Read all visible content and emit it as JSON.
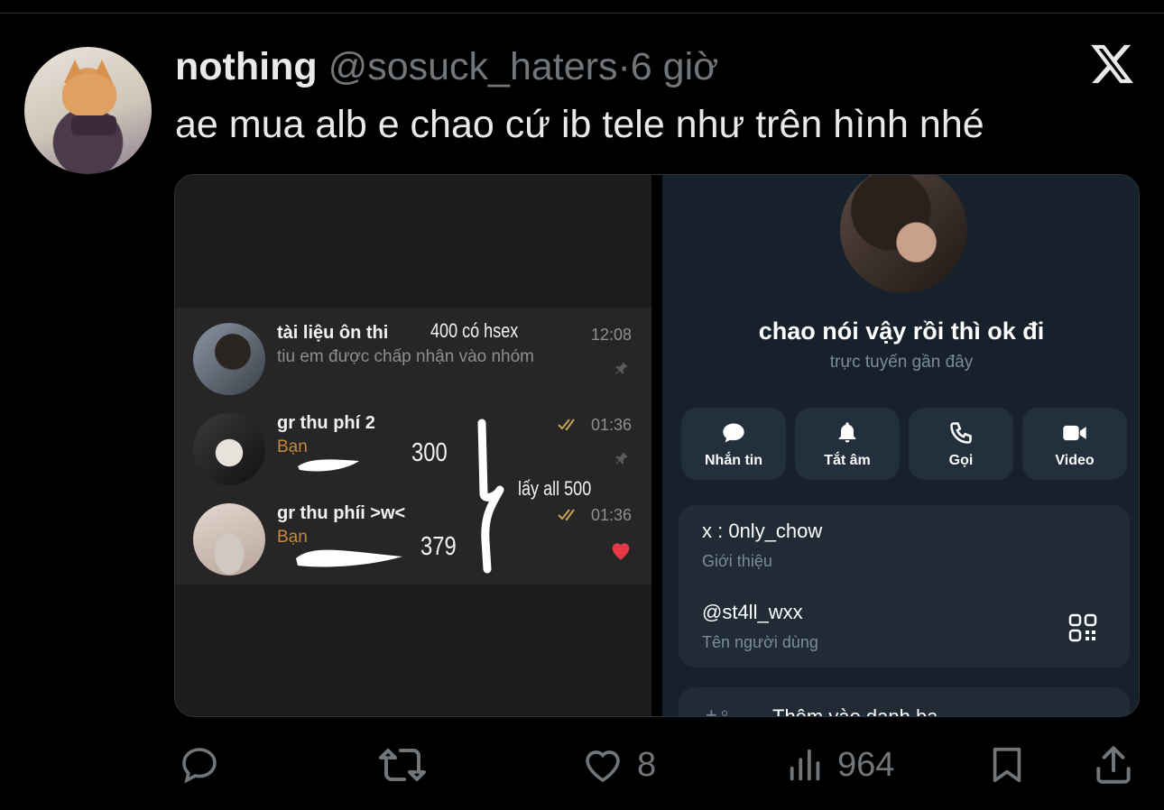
{
  "tweet": {
    "name": "nothing",
    "handle": "@sosuck_haters",
    "separator": "·",
    "time": "6 giờ",
    "text": "ae mua alb e chao cứ ib tele như trên hình nhé"
  },
  "media": {
    "chats": [
      {
        "title": "tài liệu ôn thi",
        "subtitle": "tiu em được chấp nhận vào nhóm",
        "time": "12:08",
        "pinned": true
      },
      {
        "title": "gr thu phí 2",
        "subtitle": "Bạn",
        "time": "01:36",
        "pinned": true
      },
      {
        "title": "gr thu phíi >w<",
        "subtitle": "Bạn",
        "time": "01:36",
        "pinned": false
      }
    ],
    "annotations": {
      "a1": "400 có hsex",
      "a2": "300",
      "a3": "lấy all 500",
      "a4": "379"
    },
    "profile": {
      "name": "chao nói vậy rồi thì ok đi",
      "status": "trực tuyến gần đây",
      "buttons": [
        {
          "label": "Nhắn tin",
          "icon": "message-icon"
        },
        {
          "label": "Tắt âm",
          "icon": "bell-icon"
        },
        {
          "label": "Gọi",
          "icon": "phone-icon"
        },
        {
          "label": "Video",
          "icon": "video-icon"
        }
      ],
      "bio_value": "x : 0nly_chow",
      "bio_label": "Giới thiệu",
      "username_value": "@st4ll_wxx",
      "username_label": "Tên người dùng",
      "add_contact": "Thêm vào danh bạ"
    }
  },
  "actions": {
    "reply_count": "",
    "retweet_count": "",
    "like_count": "8",
    "view_count": "964"
  },
  "colors": {
    "background": "#000000",
    "text": "#e7e9ea",
    "muted": "#71767b",
    "telegram_bg": "#17212b",
    "heart": "#e53945"
  }
}
